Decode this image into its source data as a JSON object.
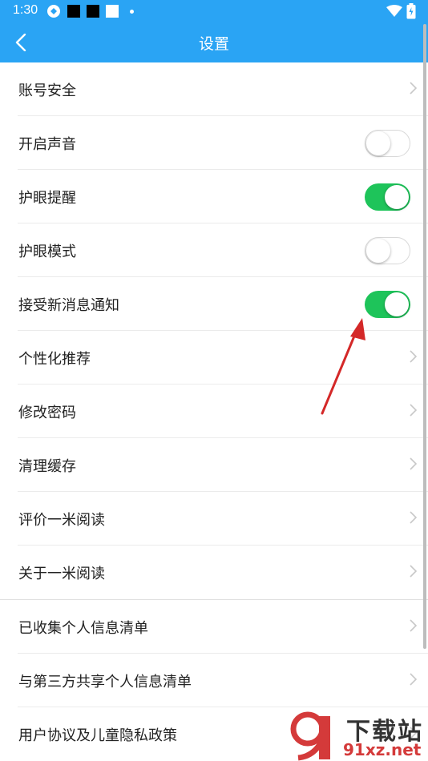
{
  "status_bar": {
    "time": "1:30"
  },
  "nav": {
    "title": "设置"
  },
  "settings": [
    {
      "label": "账号安全",
      "control": "chevron"
    },
    {
      "label": "开启声音",
      "control": "toggle",
      "on": false
    },
    {
      "label": "护眼提醒",
      "control": "toggle",
      "on": true
    },
    {
      "label": "护眼模式",
      "control": "toggle",
      "on": false
    },
    {
      "label": "接受新消息通知",
      "control": "toggle",
      "on": true
    },
    {
      "label": "个性化推荐",
      "control": "chevron"
    },
    {
      "label": "修改密码",
      "control": "chevron"
    },
    {
      "label": "清理缓存",
      "control": "chevron"
    },
    {
      "label": "评价一米阅读",
      "control": "chevron"
    },
    {
      "label": "关于一米阅读",
      "control": "chevron"
    },
    {
      "label": "已收集个人信息清单",
      "control": "chevron"
    },
    {
      "label": "与第三方共享个人信息清单",
      "control": "chevron"
    },
    {
      "label": "用户协议及儿童隐私政策",
      "control": "chevron"
    }
  ],
  "watermark": {
    "text_top": "下载站",
    "text_bottom": "91xz.net"
  },
  "colors": {
    "header": "#2aa4f4",
    "toggle_on": "#1ec45a",
    "arrow": "#d42828"
  }
}
